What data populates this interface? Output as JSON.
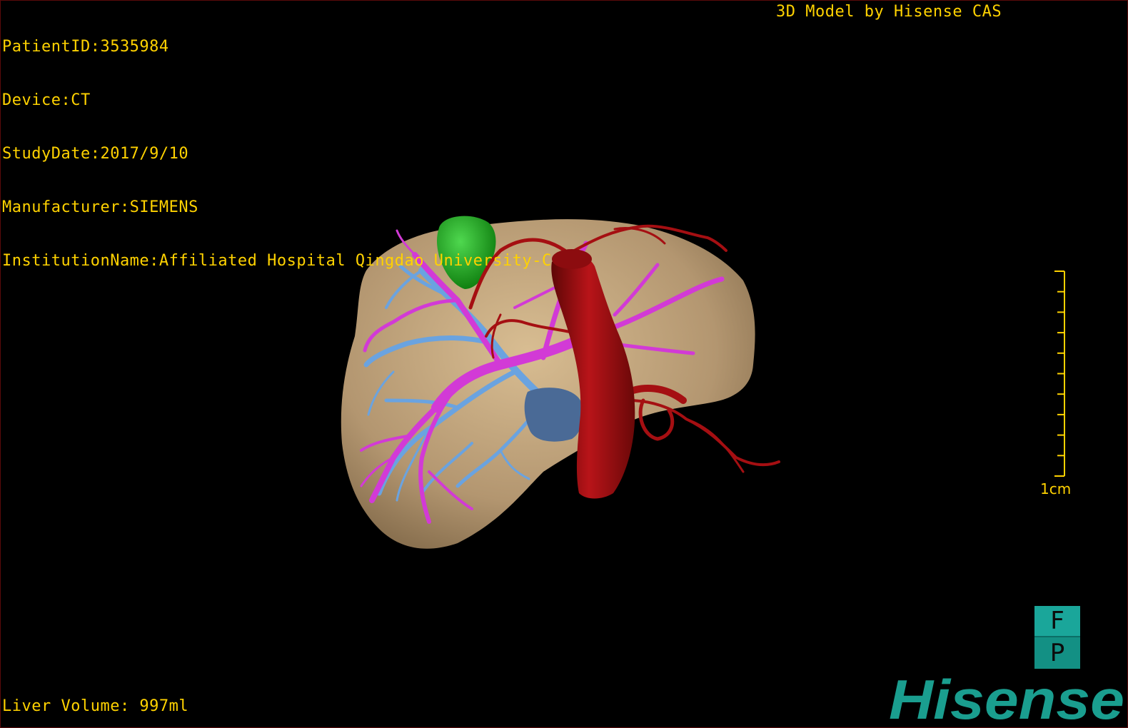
{
  "info": {
    "patient_id": "PatientID:3535984",
    "device": "Device:CT",
    "study_date": "StudyDate:2017/9/10",
    "manufacturer": "Manufacturer:SIEMENS",
    "institution": "InstitutionName:Affiliated Hospital Qingdao University-C"
  },
  "vendor_caption": "3D Model by Hisense CAS",
  "liver_volume": "Liver Volume: 997ml",
  "scale": {
    "label": "1cm",
    "tick_count": 10
  },
  "orientation": {
    "top_face": "F",
    "bottom_face": "P"
  },
  "brand": {
    "name": "Hisense",
    "color": "#1a9e8f"
  },
  "colors": {
    "overlay_text": "#ffd200",
    "liver": "#bfa27a",
    "portal_vein": "#d23ad6",
    "hepatic_vein": "#6aa3e0",
    "artery_aorta": "#a50f12",
    "gallbladder": "#1a9a1a",
    "ivc": "#4a6a96"
  }
}
